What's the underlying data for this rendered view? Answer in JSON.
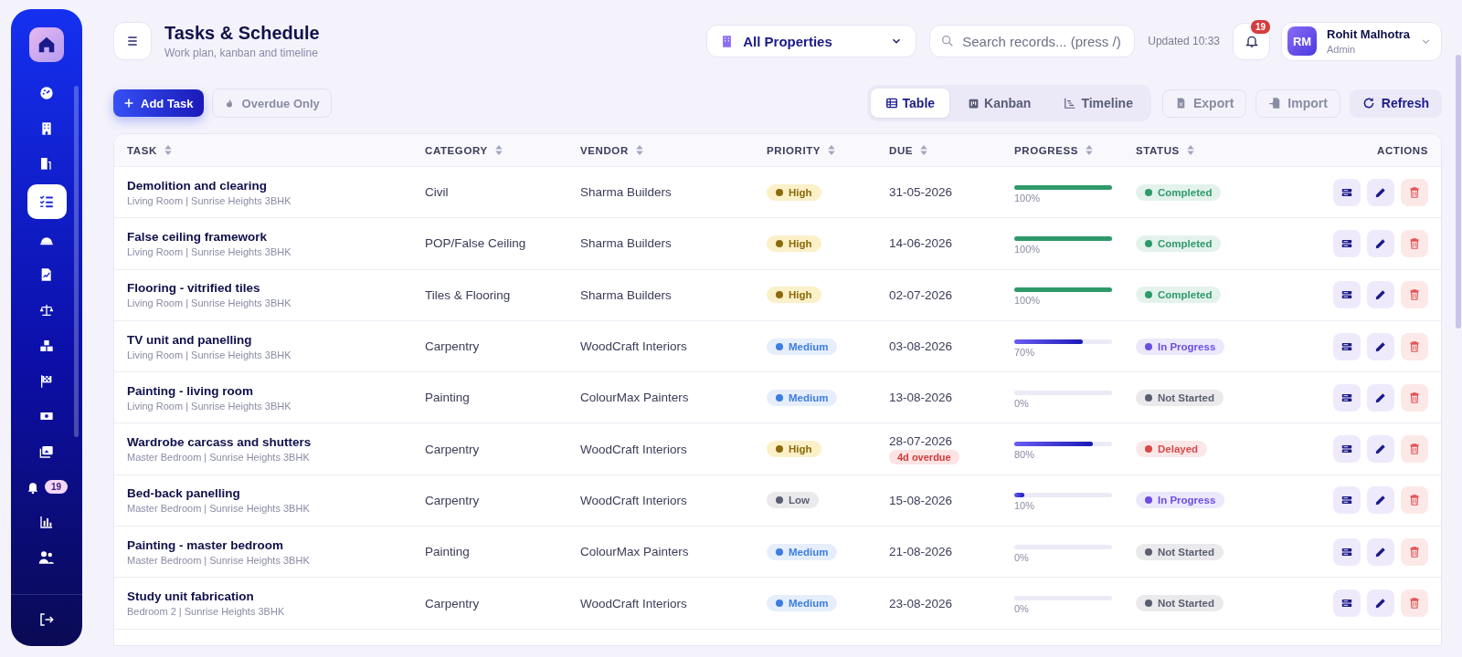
{
  "sidebar": {
    "items": [
      {
        "selected": false
      },
      {
        "selected": false
      },
      {
        "selected": false
      },
      {
        "selected": true
      },
      {
        "selected": false
      },
      {
        "selected": false
      },
      {
        "selected": false
      },
      {
        "selected": false
      },
      {
        "selected": false
      },
      {
        "selected": false
      },
      {
        "selected": false
      },
      {
        "selected": false,
        "badge": "19"
      },
      {
        "selected": false
      },
      {
        "selected": false
      }
    ]
  },
  "header": {
    "title": "Tasks & Schedule",
    "subtitle": "Work plan, kanban and timeline",
    "property_select": {
      "value": "All Properties"
    },
    "search": {
      "placeholder": "Search records... (press /)"
    },
    "updated": "Updated 10:33",
    "notifications": {
      "badge": "19"
    },
    "user": {
      "initials": "RM",
      "name": "Rohit Malhotra",
      "role": "Admin"
    }
  },
  "toolbar": {
    "add_button": "Add Task",
    "filter_button": {
      "label": "Overdue Only",
      "on": false
    },
    "view_tabs": [
      {
        "label": "Table",
        "selected": true
      },
      {
        "label": "Kanban",
        "selected": false
      },
      {
        "label": "Timeline",
        "selected": false
      }
    ],
    "actions": [
      {
        "label": "Export",
        "kind": "muted"
      },
      {
        "label": "Import",
        "kind": "muted"
      },
      {
        "label": "Refresh",
        "kind": "primary"
      }
    ]
  },
  "table": {
    "columns": [
      {
        "label": "TASK",
        "sortable": true
      },
      {
        "label": "CATEGORY",
        "sortable": true
      },
      {
        "label": "VENDOR",
        "sortable": true
      },
      {
        "label": "PRIORITY",
        "sortable": true
      },
      {
        "label": "DUE",
        "sortable": true
      },
      {
        "label": "PROGRESS",
        "sortable": true
      },
      {
        "label": "STATUS",
        "sortable": true
      },
      {
        "label": "ACTIONS",
        "sortable": false
      }
    ],
    "rows": [
      {
        "task": "Demolition and clearing",
        "location": "Living Room | Sunrise Heights 3BHK",
        "category": "Civil",
        "vendor": "Sharma Builders",
        "priority": {
          "label": "High",
          "color": "#8a6a0a"
        },
        "due": "31-05-2026",
        "progress": {
          "level": 1,
          "reading": "100%"
        },
        "status": {
          "label": "Completed",
          "color": "#2e9a6a"
        }
      },
      {
        "task": "False ceiling framework",
        "location": "Living Room | Sunrise Heights 3BHK",
        "category": "POP/False Ceiling",
        "vendor": "Sharma Builders",
        "priority": {
          "label": "High",
          "color": "#8a6a0a"
        },
        "due": "14-06-2026",
        "progress": {
          "level": 1,
          "reading": "100%"
        },
        "status": {
          "label": "Completed",
          "color": "#2e9a6a"
        }
      },
      {
        "task": "Flooring - vitrified tiles",
        "location": "Living Room | Sunrise Heights 3BHK",
        "category": "Tiles & Flooring",
        "vendor": "Sharma Builders",
        "priority": {
          "label": "High",
          "color": "#8a6a0a"
        },
        "due": "02-07-2026",
        "progress": {
          "level": 1,
          "reading": "100%"
        },
        "status": {
          "label": "Completed",
          "color": "#2e9a6a"
        }
      },
      {
        "task": "TV unit and panelling",
        "location": "Living Room | Sunrise Heights 3BHK",
        "category": "Carpentry",
        "vendor": "WoodCraft Interiors",
        "priority": {
          "label": "Medium",
          "color": "#3b7de0"
        },
        "due": "03-08-2026",
        "progress": {
          "level": 0.7,
          "reading": "70%"
        },
        "status": {
          "label": "In Progress",
          "color": "#6a4fe0"
        }
      },
      {
        "task": "Painting - living room",
        "location": "Living Room | Sunrise Heights 3BHK",
        "category": "Painting",
        "vendor": "ColourMax Painters",
        "priority": {
          "label": "Medium",
          "color": "#3b7de0"
        },
        "due": "13-08-2026",
        "progress": {
          "level": 0,
          "reading": "0%"
        },
        "status": {
          "label": "Not Started",
          "color": "#5a5e70"
        }
      },
      {
        "task": "Wardrobe carcass and shutters",
        "location": "Master Bedroom | Sunrise Heights 3BHK",
        "category": "Carpentry",
        "vendor": "WoodCraft Interiors",
        "priority": {
          "label": "High",
          "color": "#8a6a0a"
        },
        "due": "28-07-2026",
        "overdue": "4d overdue",
        "progress": {
          "level": 0.8,
          "reading": "80%"
        },
        "status": {
          "label": "Delayed",
          "color": "#d94848"
        }
      },
      {
        "task": "Bed-back panelling",
        "location": "Master Bedroom | Sunrise Heights 3BHK",
        "category": "Carpentry",
        "vendor": "WoodCraft Interiors",
        "priority": {
          "label": "Low",
          "color": "#5a5e70"
        },
        "due": "15-08-2026",
        "progress": {
          "level": 0.1,
          "reading": "10%"
        },
        "status": {
          "label": "In Progress",
          "color": "#6a4fe0"
        }
      },
      {
        "task": "Painting - master bedroom",
        "location": "Master Bedroom | Sunrise Heights 3BHK",
        "category": "Painting",
        "vendor": "ColourMax Painters",
        "priority": {
          "label": "Medium",
          "color": "#3b7de0"
        },
        "due": "21-08-2026",
        "progress": {
          "level": 0,
          "reading": "0%"
        },
        "status": {
          "label": "Not Started",
          "color": "#5a5e70"
        }
      },
      {
        "task": "Study unit fabrication",
        "location": "Bedroom 2 | Sunrise Heights 3BHK",
        "category": "Carpentry",
        "vendor": "WoodCraft Interiors",
        "priority": {
          "label": "Medium",
          "color": "#3b7de0"
        },
        "due": "23-08-2026",
        "progress": {
          "level": 0,
          "reading": "0%"
        },
        "status": {
          "label": "Not Started",
          "color": "#5a5e70"
        }
      }
    ]
  }
}
